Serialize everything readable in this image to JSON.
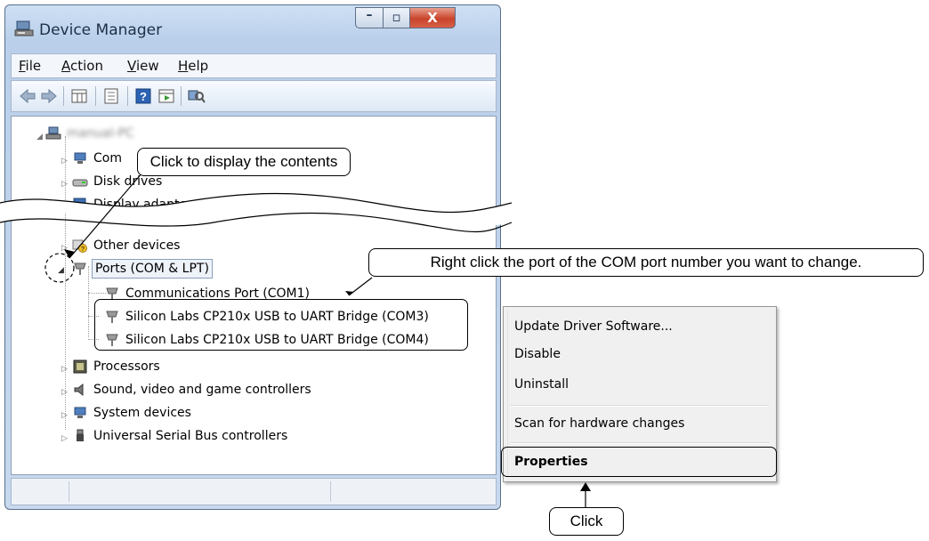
{
  "window": {
    "title": "Device Manager",
    "caption_min_glyph": "–",
    "caption_max_glyph": "▫",
    "caption_close_glyph": "X"
  },
  "menu": {
    "file": {
      "accel": "F",
      "rest": "ile"
    },
    "action": {
      "accel": "A",
      "rest": "ction"
    },
    "view": {
      "accel": "V",
      "rest": "iew"
    },
    "help": {
      "accel": "H",
      "rest": "elp"
    }
  },
  "toolbar": {
    "icons": [
      "back-arrow-icon",
      "forward-arrow-icon",
      "properties-grid-icon",
      "driver-page-icon",
      "help-icon",
      "update-driver-icon",
      "scan-hardware-icon"
    ]
  },
  "tree": {
    "root_label": "manual-PC",
    "items": {
      "computer": "Com",
      "disk_drives": "Disk drives",
      "display_adapters": "Display adapters",
      "other_devices": "Other devices",
      "ports": "Ports (COM & LPT)",
      "port_com1": "Communications Port (COM1)",
      "port_com3": "Silicon Labs CP210x USB to UART Bridge (COM3)",
      "port_com4": "Silicon Labs CP210x USB to UART Bridge (COM4)",
      "processors": "Processors",
      "sound": "Sound, video and game controllers",
      "system": "System devices",
      "usb": "Universal Serial Bus controllers"
    }
  },
  "context_menu": {
    "update": "Update Driver Software...",
    "disable": "Disable",
    "uninstall": "Uninstall",
    "scan": "Scan for hardware changes",
    "properties": "Properties"
  },
  "callouts": {
    "expand": "Click to display the contents",
    "right_click": "Right click the port of the COM port number you want to change.",
    "click": "Click"
  },
  "colors": {
    "frame": "#b9cfea",
    "close_button": "#c9432b"
  }
}
